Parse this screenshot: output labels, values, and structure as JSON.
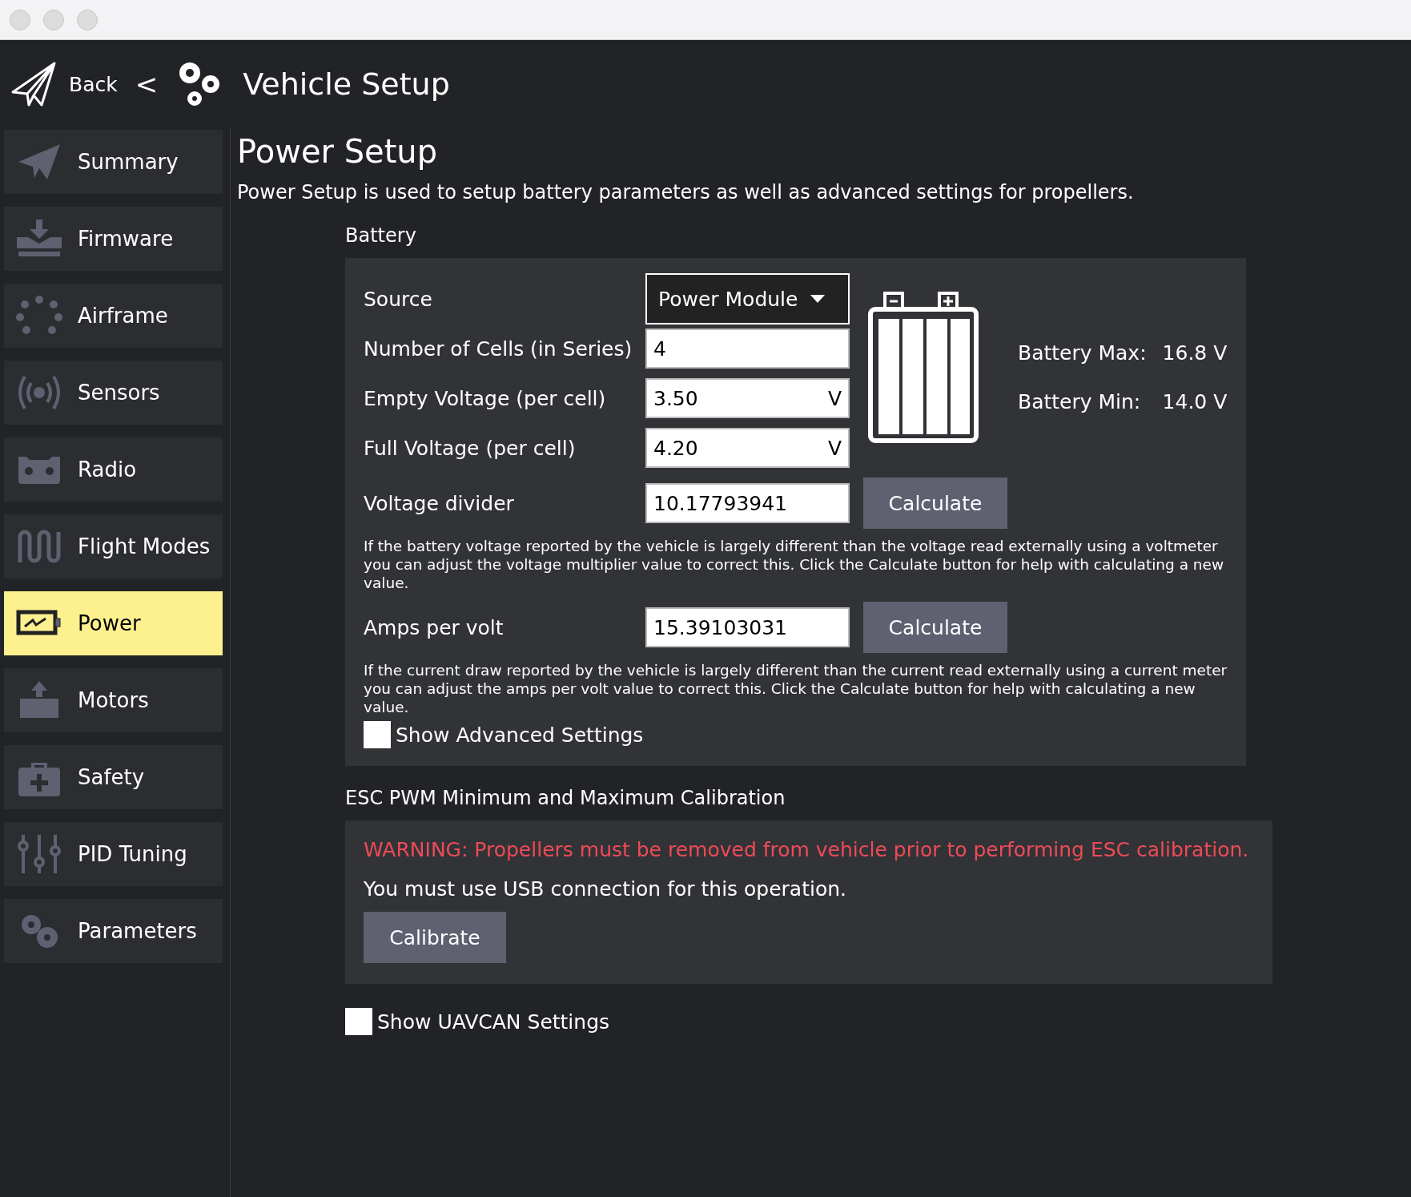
{
  "header": {
    "back": "Back",
    "separator": "<",
    "title": "Vehicle Setup"
  },
  "sidebar": {
    "items": [
      {
        "label": "Summary",
        "selected": false
      },
      {
        "label": "Firmware",
        "selected": false
      },
      {
        "label": "Airframe",
        "selected": false
      },
      {
        "label": "Sensors",
        "selected": false
      },
      {
        "label": "Radio",
        "selected": false
      },
      {
        "label": "Flight Modes",
        "selected": false
      },
      {
        "label": "Power",
        "selected": true
      },
      {
        "label": "Motors",
        "selected": false
      },
      {
        "label": "Safety",
        "selected": false
      },
      {
        "label": "PID Tuning",
        "selected": false
      },
      {
        "label": "Parameters",
        "selected": false
      }
    ]
  },
  "page": {
    "title": "Power Setup",
    "description": "Power Setup is used to setup battery parameters as well as advanced settings for propellers."
  },
  "battery": {
    "heading": "Battery",
    "rows": [
      {
        "kind": "dropdown",
        "label": "Source",
        "value": "Power Module"
      },
      {
        "kind": "input",
        "label": "Number of Cells (in Series)",
        "value": "4"
      },
      {
        "kind": "input",
        "label": "Empty Voltage (per cell)",
        "value": "3.50",
        "unit": "V"
      },
      {
        "kind": "input",
        "label": "Full Voltage (per cell)",
        "value": "4.20",
        "unit": "V"
      },
      {
        "kind": "input",
        "label": "Voltage divider",
        "value": "10.17793941",
        "button": "Calculate",
        "help": "If the battery voltage reported by the vehicle is largely different than the voltage read externally using a voltmeter you can adjust the voltage multiplier value to correct this. Click the Calculate button for help with calculating a new value."
      },
      {
        "kind": "input",
        "label": "Amps per volt",
        "value": "15.39103031",
        "button": "Calculate",
        "help": "If the current draw reported by the vehicle is largely different than the current read externally using a current meter you can adjust the amps per volt value to correct this. Click the Calculate button for help with calculating a new value."
      }
    ],
    "max_label": "Battery Max:",
    "max_value": "16.8 V",
    "min_label": "Battery Min:",
    "min_value": "14.0 V",
    "advanced": {
      "label": "Show Advanced Settings",
      "checked": false
    }
  },
  "esc": {
    "heading": "ESC PWM Minimum and Maximum Calibration",
    "warning": "WARNING: Propellers must be removed from vehicle prior to performing ESC calibration.",
    "note": "You must use USB connection for this operation.",
    "button": "Calibrate"
  },
  "uavcan": {
    "label": "Show UAVCAN Settings",
    "checked": false
  }
}
